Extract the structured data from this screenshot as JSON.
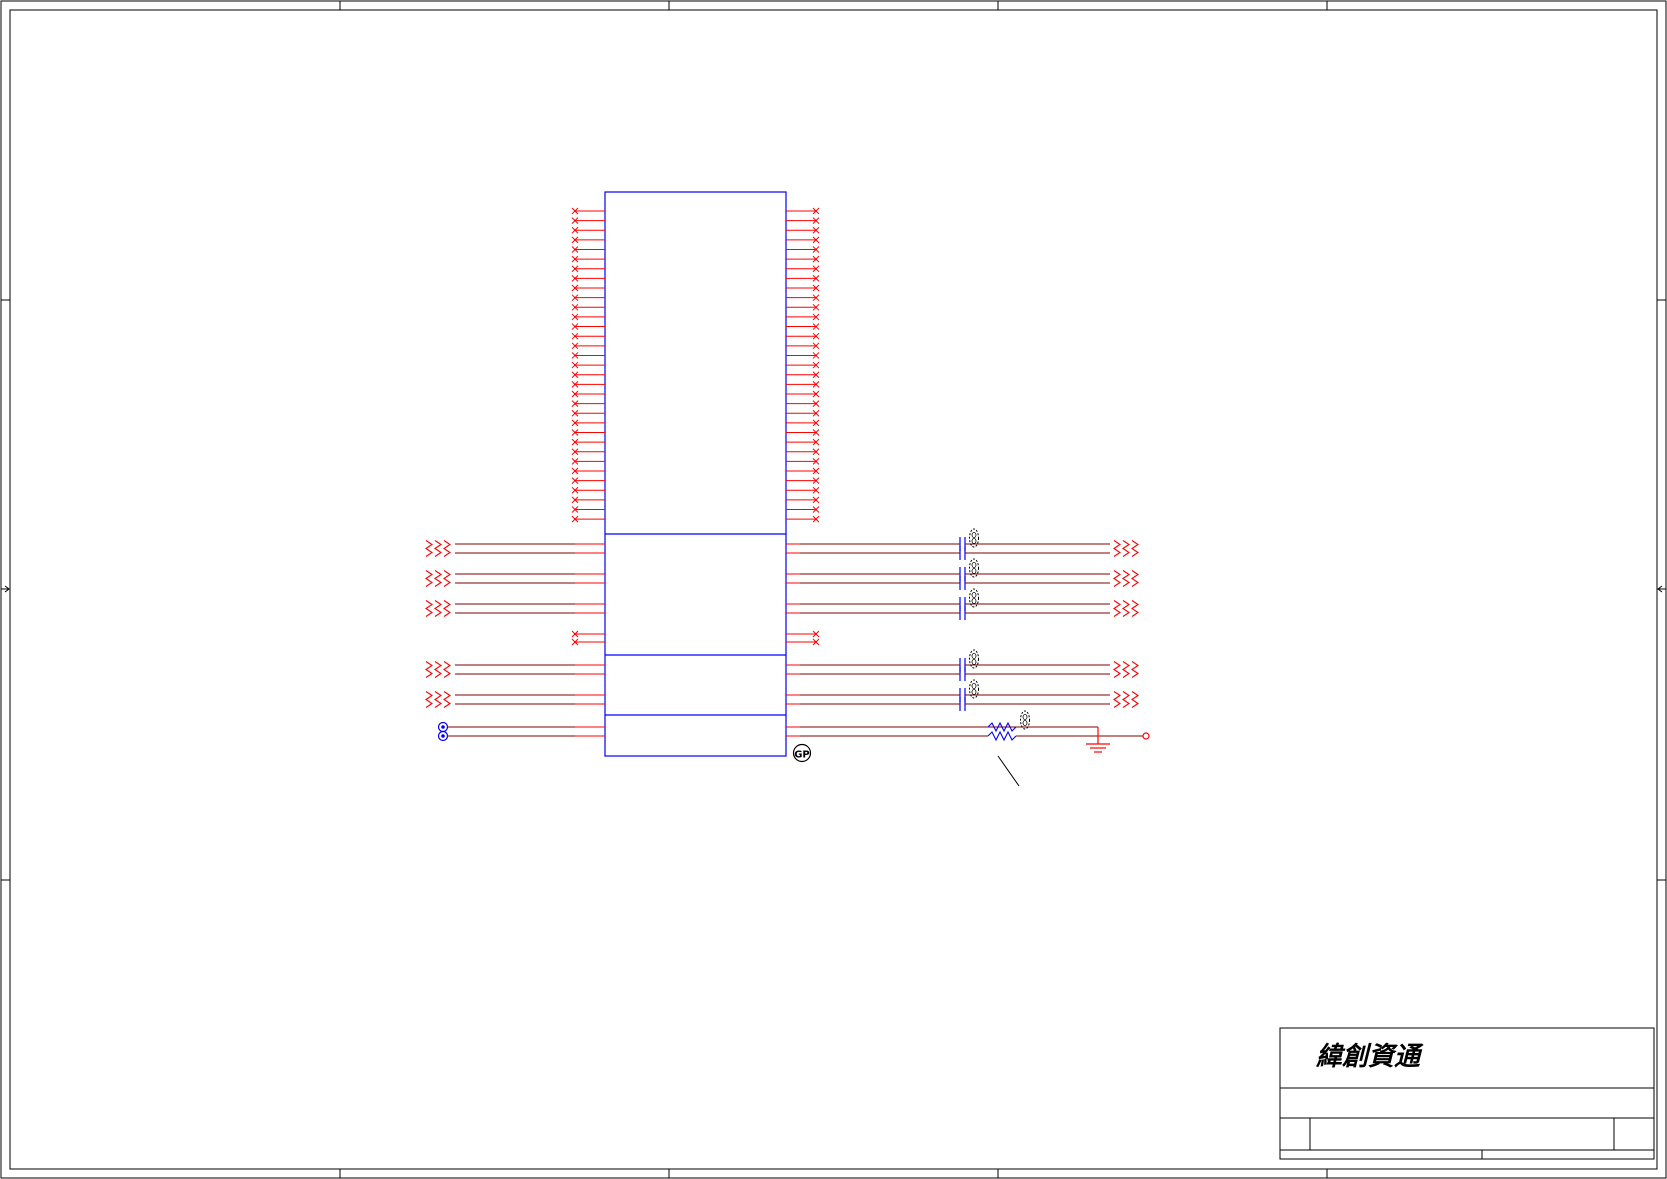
{
  "page": {
    "title": "",
    "background": "#ffffff"
  },
  "colors": {
    "frame": "#000000",
    "component": "#0000ff",
    "wire": "#ff0000",
    "net": "#800000",
    "ground": "#ff0000"
  },
  "title_block": {
    "company": "緯創資通",
    "logo_icon": "wistron-text-logo"
  },
  "connector": {
    "top_section_pins_per_side": 33,
    "diff_pairs_upper": 3,
    "diff_pairs_lower": 2,
    "input_coupling_pins": 2
  },
  "symbols": {
    "off_page_connector_icon": "triple-chevron-icon",
    "ac_cap_icon": "capacitor-icon",
    "resistor_icon": "resistor-icon",
    "ground_icon": "ground-icon",
    "test_point_icon": "circle-terminal-icon",
    "gp_mark_icon": "gp-badge-icon",
    "unpopulated_marker_icon": "dashed-oval-icon"
  }
}
